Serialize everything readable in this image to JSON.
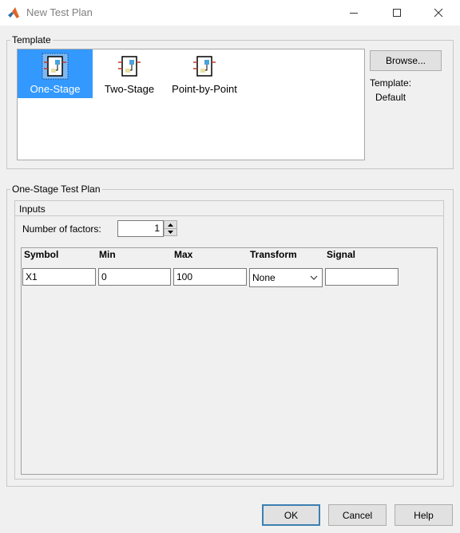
{
  "window": {
    "title": "New Test Plan"
  },
  "template_group": {
    "title": "Template",
    "items": [
      {
        "label": "One-Stage",
        "selected": true,
        "icon": "one-stage-plan-icon"
      },
      {
        "label": "Two-Stage",
        "selected": false,
        "icon": "two-stage-plan-icon"
      },
      {
        "label": "Point-by-Point",
        "selected": false,
        "icon": "point-by-point-plan-icon"
      }
    ],
    "browse_label": "Browse...",
    "template_caption": "Template:",
    "template_value": "Default"
  },
  "plan_group": {
    "title": "One-Stage Test Plan",
    "inputs_title": "Inputs",
    "factors_label": "Number of factors:",
    "factors_value": "1",
    "columns": [
      "Symbol",
      "Min",
      "Max",
      "Transform",
      "Signal"
    ],
    "row": {
      "symbol": "X1",
      "min": "0",
      "max": "100",
      "transform": "None",
      "signal": ""
    }
  },
  "buttons": {
    "ok": "OK",
    "cancel": "Cancel",
    "help": "Help"
  },
  "colors": {
    "selection": "#3399ff",
    "dialog_bg": "#f0f0f0",
    "default_button_border": "#3c7fb1"
  }
}
